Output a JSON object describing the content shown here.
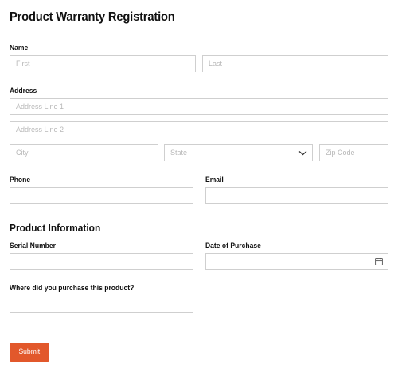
{
  "form": {
    "title": "Product Warranty Registration",
    "submit_label": "Submit",
    "accent_color": "#e2582b"
  },
  "name": {
    "label": "Name",
    "first_placeholder": "First",
    "last_placeholder": "Last"
  },
  "address": {
    "label": "Address",
    "line1_placeholder": "Address Line 1",
    "line2_placeholder": "Address Line 2",
    "city_placeholder": "City",
    "state_placeholder": "State",
    "zip_placeholder": "Zip Code",
    "state_icon": "chevron-down-icon"
  },
  "contact": {
    "phone_label": "Phone",
    "email_label": "Email"
  },
  "product": {
    "section_title": "Product Information",
    "serial_label": "Serial Number",
    "date_label": "Date of Purchase",
    "date_icon": "calendar-icon",
    "where_label": "Where did you purchase this product?"
  }
}
